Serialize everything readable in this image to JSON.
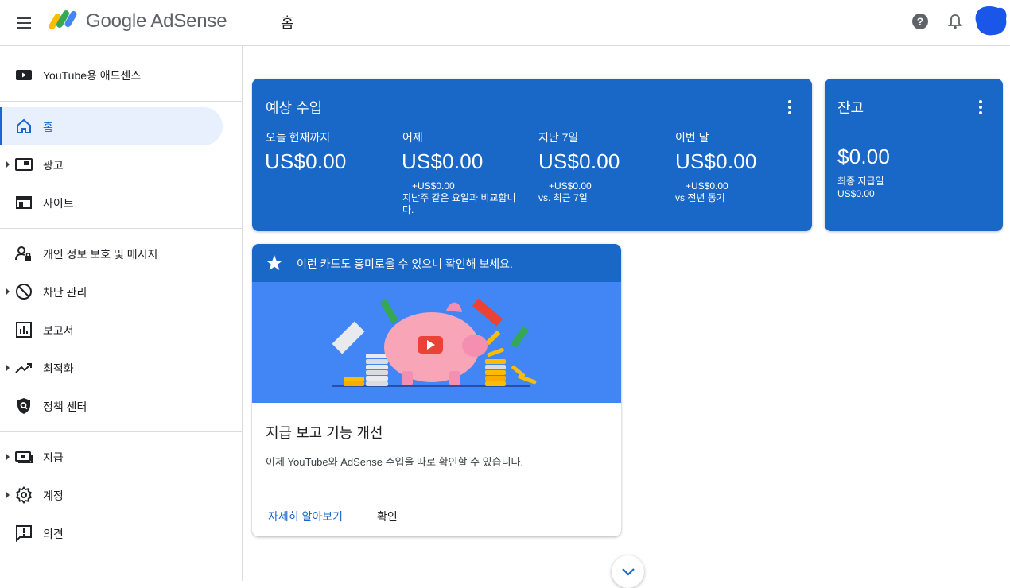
{
  "header": {
    "logo_text": "Google AdSense",
    "page_title": "홈",
    "icons": [
      "menu-icon",
      "adsense-logo",
      "help-icon",
      "notifications-icon",
      "avatar"
    ],
    "avatar_color": "#1a56e8"
  },
  "sidebar": {
    "items": [
      {
        "label": "YouTube용 애드센스",
        "icon": "youtube-icon"
      },
      {
        "label": "홈",
        "icon": "home-icon",
        "active": true
      },
      {
        "label": "광고",
        "icon": "ads-icon",
        "expandable": true
      },
      {
        "label": "사이트",
        "icon": "sites-icon"
      },
      {
        "label": "개인 정보 보호 및 메시지",
        "icon": "privacy-icon"
      },
      {
        "label": "차단 관리",
        "icon": "block-icon",
        "expandable": true
      },
      {
        "label": "보고서",
        "icon": "reports-icon"
      },
      {
        "label": "최적화",
        "icon": "optimization-icon",
        "expandable": true
      },
      {
        "label": "정책 센터",
        "icon": "policy-icon"
      },
      {
        "label": "지급",
        "icon": "payments-icon",
        "expandable": true
      },
      {
        "label": "계정",
        "icon": "settings-icon",
        "expandable": true
      },
      {
        "label": "의견",
        "icon": "feedback-icon"
      }
    ]
  },
  "earnings": {
    "title": "예상 수입",
    "metrics": [
      {
        "label": "오늘 현재까지",
        "value": "US$0.00",
        "delta": "",
        "note": ""
      },
      {
        "label": "어제",
        "value": "US$0.00",
        "delta": "+US$0.00",
        "note": "지난주 같은 요일과 비교합니다."
      },
      {
        "label": "지난 7일",
        "value": "US$0.00",
        "delta": "+US$0.00",
        "note": "vs. 최근 7일"
      },
      {
        "label": "이번 달",
        "value": "US$0.00",
        "delta": "+US$0.00",
        "note": "vs 전년 동기"
      }
    ]
  },
  "balance": {
    "title": "잔고",
    "value": "$0.00",
    "last_payment_label": "최종 지급일",
    "last_payment_value": "US$0.00"
  },
  "promo": {
    "header": "이런 카드도 흥미로울 수 있으니 확인해 보세요.",
    "title": "지급 보고 기능 개선",
    "body": "이제 YouTube와 AdSense 수입을 따로 확인할 수 있습니다.",
    "learn_more": "자세히 알아보기",
    "confirm": "확인"
  },
  "colors": {
    "card_blue": "#1967c6",
    "illustration_blue": "#4285f4",
    "active_nav": "#e8f0fe",
    "link": "#1967d2"
  }
}
